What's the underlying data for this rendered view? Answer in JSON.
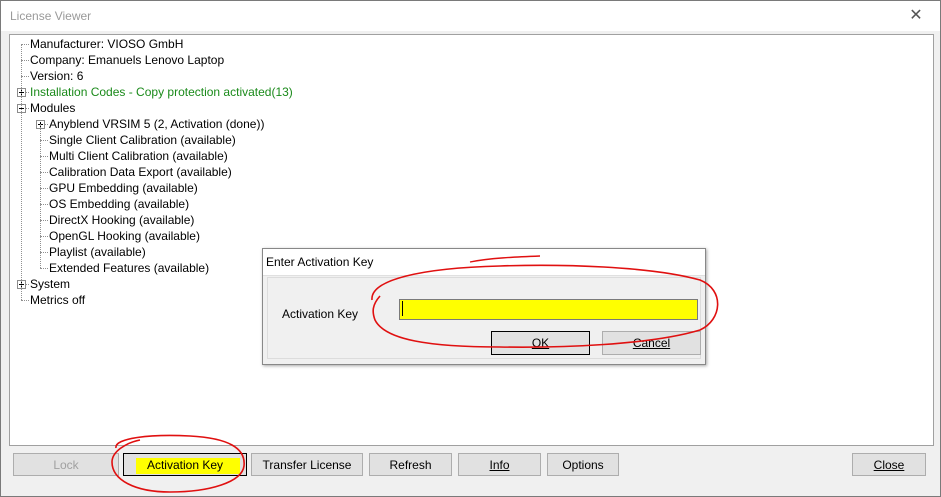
{
  "window": {
    "title": "License Viewer",
    "close_glyph": "✕"
  },
  "tree": {
    "items": [
      {
        "label": "Manufacturer: VIOSO GmbH",
        "level": 0,
        "expander": "none"
      },
      {
        "label": "Company: Emanuels Lenovo Laptop",
        "level": 0,
        "expander": "none"
      },
      {
        "label": "Version: 6",
        "level": 0,
        "expander": "none"
      },
      {
        "label": "Installation Codes - Copy protection activated(13)",
        "level": 0,
        "expander": "plus",
        "color": "#1a8a1a"
      },
      {
        "label": "Modules",
        "level": 0,
        "expander": "minus"
      },
      {
        "label": "Anyblend VRSIM 5 (2, Activation (done))",
        "level": 1,
        "expander": "plus"
      },
      {
        "label": "Single Client Calibration (available)",
        "level": 1,
        "expander": "none"
      },
      {
        "label": "Multi Client Calibration (available)",
        "level": 1,
        "expander": "none"
      },
      {
        "label": "Calibration Data Export (available)",
        "level": 1,
        "expander": "none"
      },
      {
        "label": "GPU Embedding (available)",
        "level": 1,
        "expander": "none"
      },
      {
        "label": "OS Embedding (available)",
        "level": 1,
        "expander": "none"
      },
      {
        "label": "DirectX Hooking (available)",
        "level": 1,
        "expander": "none"
      },
      {
        "label": "OpenGL Hooking (available)",
        "level": 1,
        "expander": "none"
      },
      {
        "label": "Playlist (available)",
        "level": 1,
        "expander": "none"
      },
      {
        "label": "Extended Features (available)",
        "level": 1,
        "expander": "none"
      },
      {
        "label": "System",
        "level": 0,
        "expander": "plus"
      },
      {
        "label": "Metrics off",
        "level": 0,
        "expander": "none"
      }
    ]
  },
  "buttons": {
    "lock": "Lock",
    "activation_key": "Activation Key",
    "transfer_license": "Transfer License",
    "refresh": "Refresh",
    "info": "Info",
    "options": "Options",
    "close": "Close"
  },
  "dialog": {
    "title": "Enter Activation Key",
    "field_label": "Activation Key",
    "input_value": "",
    "ok": "OK",
    "cancel": "Cancel"
  },
  "colors": {
    "highlight": "#ffff00",
    "annotation": "#e01010",
    "installation_codes": "#1a8a1a"
  }
}
